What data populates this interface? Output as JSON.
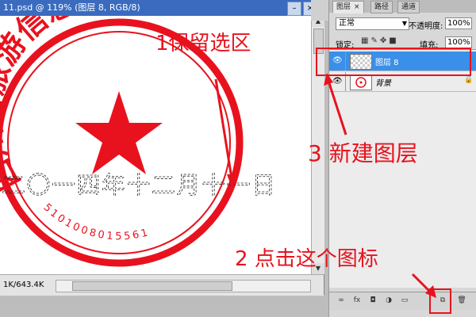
{
  "document": {
    "title": "11.psd @ 119% (图层 8, RGB/8)",
    "minimize_label": "–",
    "close_label": "×",
    "status_size": "1K/643.4K"
  },
  "panel": {
    "tabs": [
      {
        "label": "图层",
        "close": "×"
      },
      {
        "label": "路径"
      },
      {
        "label": "通道"
      }
    ],
    "blend_mode": "正常",
    "opacity_label": "不透明度:",
    "opacity_value": "100%",
    "lock_label": "锁定:",
    "fill_label": "填充:",
    "fill_value": "100%",
    "layers": [
      {
        "name": "图层 8",
        "selected": true
      },
      {
        "name": "背景",
        "selected": false
      }
    ]
  },
  "canvas": {
    "seal_top_text": "四川省旅游信息中心",
    "seal_bottom_number": "5101008015561",
    "seal_date_text": "二〇一四年十二月十一日"
  },
  "annotations": {
    "step1": "1保留选区",
    "step2": "2 点击这个图标",
    "step3": "3 新建图层"
  },
  "colors": {
    "annotation": "#e8121e",
    "seal": "#e8121e",
    "selected_layer": "#3a8fe8"
  },
  "icons": [
    "eye-icon",
    "lock-icon",
    "link-icon",
    "fx-icon",
    "mask-icon",
    "adjustment-icon",
    "folder-icon",
    "new-layer-icon",
    "trash-icon"
  ]
}
